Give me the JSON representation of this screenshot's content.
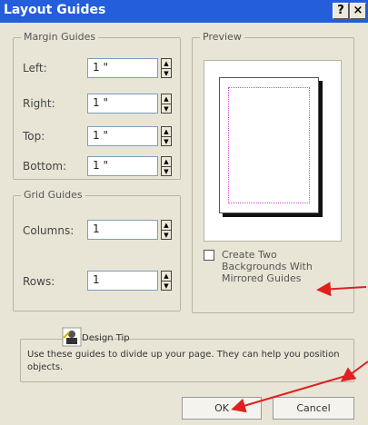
{
  "window": {
    "title": "Layout Guides",
    "help_label": "?",
    "close_label": "×"
  },
  "margin_guides": {
    "legend": "Margin Guides",
    "left": {
      "label": "Left:",
      "value": "1 \""
    },
    "right": {
      "label": "Right:",
      "value": "1 \""
    },
    "top": {
      "label": "Top:",
      "value": "1 \""
    },
    "bottom": {
      "label": "Bottom:",
      "value": "1 \""
    }
  },
  "grid_guides": {
    "legend": "Grid Guides",
    "columns": {
      "label": "Columns:",
      "value": "1"
    },
    "rows": {
      "label": "Rows:",
      "value": "1"
    }
  },
  "preview": {
    "legend": "Preview"
  },
  "mirrored": {
    "line1": "Create Two",
    "line2": "Backgrounds With",
    "line3": "Mirrored Guides",
    "checked": false
  },
  "design_tip": {
    "title": "Design Tip",
    "text": "Use these guides to divide up your page.  They can help you position objects."
  },
  "buttons": {
    "ok": "OK",
    "cancel": "Cancel"
  },
  "colors": {
    "titlebar": "#245edb",
    "arrow": "#e02020",
    "margin_guide": "#d04ad0"
  }
}
